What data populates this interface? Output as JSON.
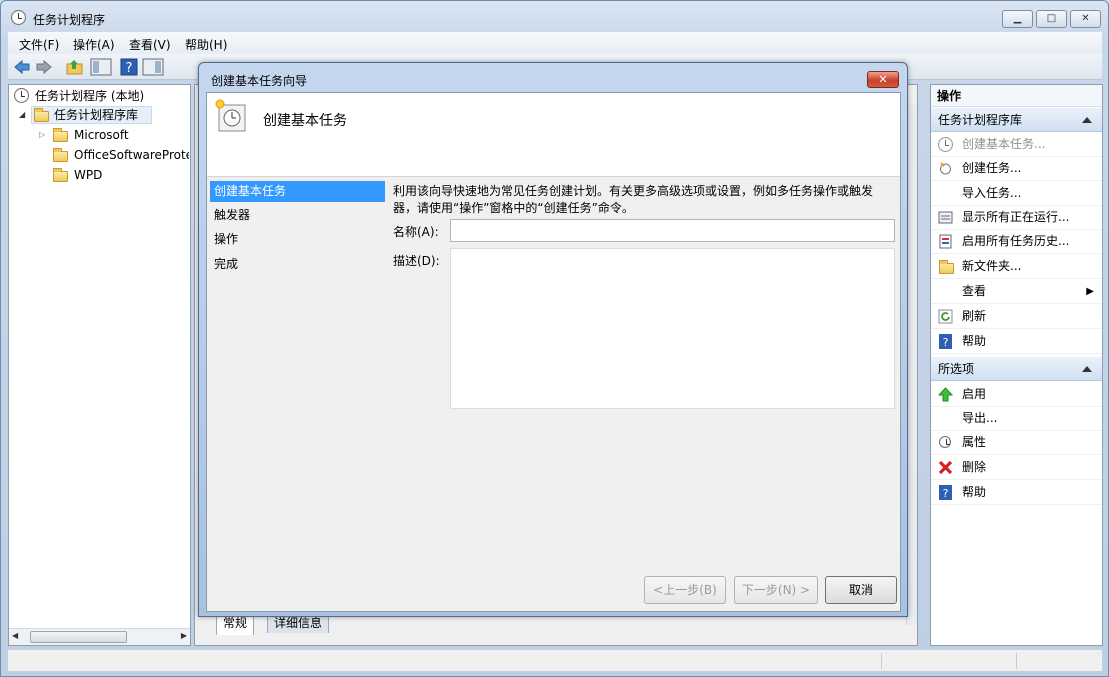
{
  "window": {
    "title": "任务计划程序",
    "min_label": "▁",
    "max_label": "□",
    "close_label": "✕"
  },
  "menu": [
    "文件(F)",
    "操作(A)",
    "查看(V)",
    "帮助(H)"
  ],
  "tree": {
    "root": "任务计划程序 (本地)",
    "library": "任务计划程序库",
    "children": [
      "Microsoft",
      "OfficeSoftwareProte",
      "WPD"
    ]
  },
  "actions_pane": {
    "header": "操作",
    "section1": {
      "title": "任务计划程序库",
      "items": [
        "创建基本任务...",
        "创建任务...",
        "导入任务...",
        "显示所有正在运行...",
        "启用所有任务历史...",
        "新文件夹...",
        "查看",
        "刷新",
        "帮助"
      ]
    },
    "section2": {
      "title": "所选项",
      "items": [
        "启用",
        "导出...",
        "属性",
        "删除",
        "帮助"
      ]
    }
  },
  "bottom_tabs": [
    "常规",
    "详细信息"
  ],
  "dialog": {
    "title": "创建基本任务向导",
    "close_label": "✕",
    "header_title": "创建基本任务",
    "nav": [
      "创建基本任务",
      "触发器",
      "操作",
      "完成"
    ],
    "description": "利用该向导快速地为常见任务创建计划。有关更多高级选项或设置，例如多任务操作或触发器，请使用“操作”窗格中的“创建任务”命令。",
    "name_label": "名称(A):",
    "name_value": "",
    "desc_label": "描述(D):",
    "desc_value": "",
    "btn_back": "<上一步(B)",
    "btn_next": "下一步(N) >",
    "btn_cancel": "取消"
  },
  "colors": {
    "selection": "#3399ff",
    "section_header": "#cfdff2",
    "close_button": "#c8412c"
  }
}
